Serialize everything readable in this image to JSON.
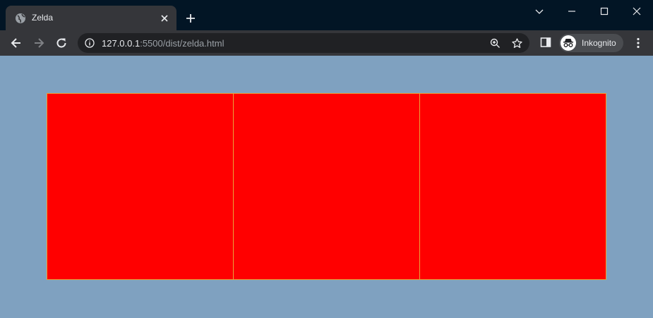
{
  "browser": {
    "tab": {
      "title": "Zelda",
      "icon": "globe-icon"
    },
    "url": {
      "host": "127.0.0.1",
      "rest": ":5500/dist/zelda.html"
    },
    "profile": {
      "label": "Inkognito",
      "icon": "incognito-icon"
    },
    "colors": {
      "titlebar": "#021525",
      "toolbar": "#35363a",
      "omnibox": "#202124"
    }
  },
  "page": {
    "background": "#7fa1c0",
    "cells": [
      {
        "color": "#ff0000"
      },
      {
        "color": "#ff0000"
      },
      {
        "color": "#ff0000"
      }
    ],
    "cell_border_color": "#e8a33a"
  }
}
